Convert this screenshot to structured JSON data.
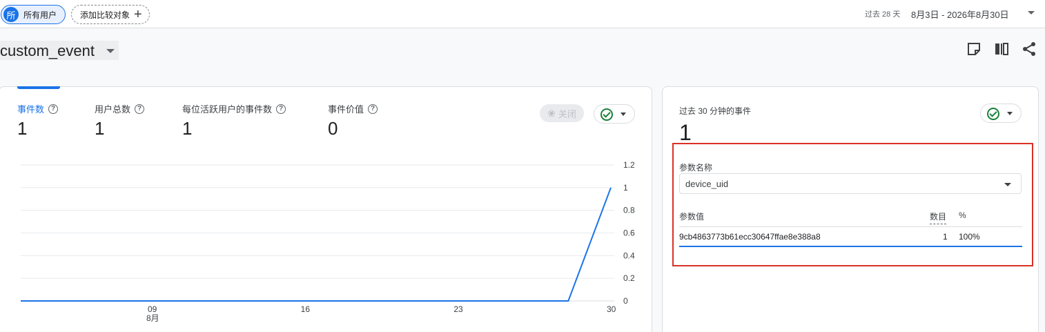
{
  "topbar": {
    "all_users_badge": "所",
    "all_users_label": "所有用户",
    "add_compare_label": "添加比较对象",
    "add_icon": "plus-icon",
    "date_prefix": "过去 28 天",
    "date_range": "8月3日 - 2026年8月30日"
  },
  "header": {
    "title": "custom_event",
    "tools": [
      "note-icon",
      "compare-columns-icon",
      "share-icon"
    ]
  },
  "metrics": [
    {
      "label": "事件数",
      "value": "1",
      "active": true
    },
    {
      "label": "用户总数",
      "value": "1",
      "active": false
    },
    {
      "label": "每位活跃用户的事件数",
      "value": "1",
      "active": false
    },
    {
      "label": "事件价值",
      "value": "0",
      "active": false
    }
  ],
  "controls": {
    "close_label": "关闭",
    "close_icon": "ribbon-icon"
  },
  "chart_data": {
    "type": "line",
    "x": [
      "8月3日",
      "8月4日",
      "8月5日",
      "8月6日",
      "8月7日",
      "8月8日",
      "8月9日",
      "8月10日",
      "8月11日",
      "8月12日",
      "8月13日",
      "8月14日",
      "8月15日",
      "8月16日",
      "8月17日",
      "8月18日",
      "8月19日",
      "8月20日",
      "8月21日",
      "8月22日",
      "8月23日",
      "8月24日",
      "8月25日",
      "8月26日",
      "8月27日",
      "8月28日",
      "8月29日",
      "8月30日"
    ],
    "series": [
      {
        "values": [
          0,
          0,
          0,
          0,
          0,
          0,
          0,
          0,
          0,
          0,
          0,
          0,
          0,
          0,
          0,
          0,
          0,
          0,
          0,
          0,
          0,
          0,
          0,
          0,
          0,
          0,
          0,
          1
        ],
        "color": "#1a73e8"
      }
    ],
    "x_ticks": [
      {
        "label": "09",
        "sub": "8月",
        "index": 6
      },
      {
        "label": "16",
        "sub": "",
        "index": 13
      },
      {
        "label": "23",
        "sub": "",
        "index": 20
      },
      {
        "label": "30",
        "sub": "",
        "index": 27
      }
    ],
    "y_ticks": [
      "0",
      "0.2",
      "0.4",
      "0.6",
      "0.8",
      "1",
      "1.2"
    ],
    "ylim": [
      0,
      1.2
    ],
    "grid": true,
    "y_axis_side": "right"
  },
  "realtime": {
    "title": "过去 30 分钟的事件",
    "value": "1",
    "param_label": "参数名称",
    "param_selected": "device_uid",
    "table_headers": {
      "value": "参数值",
      "count": "数目",
      "percent": "%"
    },
    "rows": [
      {
        "value": "9cb4863773b61ecc30647ffae8e388a8",
        "count": "1",
        "percent": "100%"
      }
    ]
  }
}
